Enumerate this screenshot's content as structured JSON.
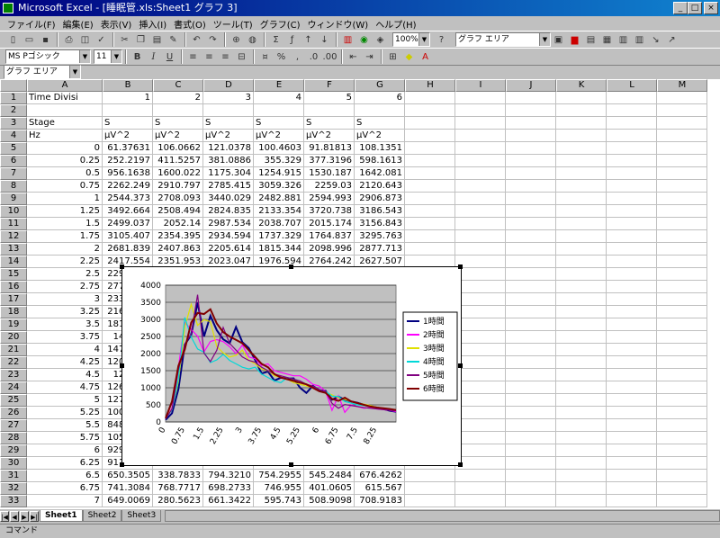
{
  "window": {
    "title": "Microsoft Excel - [睡眠管.xls:Sheet1 グラフ 3]"
  },
  "menu": [
    "ファイル(F)",
    "編集(E)",
    "表示(V)",
    "挿入(I)",
    "書式(O)",
    "ツール(T)",
    "グラフ(C)",
    "ウィンドウ(W)",
    "ヘルプ(H)"
  ],
  "toolbar": {
    "chart_area_label": "グラフ エリア",
    "zoom": "100%"
  },
  "format": {
    "font": "MS Pゴシック",
    "size": "11"
  },
  "formula": {
    "name_box": "グラフ エリア"
  },
  "columns": [
    "A",
    "B",
    "C",
    "D",
    "E",
    "F",
    "G",
    "H",
    "I",
    "J",
    "K",
    "L",
    "M"
  ],
  "rows": [
    {
      "n": "1",
      "A": "Time Divisi",
      "B": "1",
      "C": "2",
      "D": "3",
      "E": "4",
      "F": "5",
      "G": "6"
    },
    {
      "n": "2"
    },
    {
      "n": "3",
      "A": "Stage",
      "B": "S",
      "C": "S",
      "D": "S",
      "E": "S",
      "F": "S",
      "G": "S"
    },
    {
      "n": "4",
      "A": "Hz",
      "B": "μV^2",
      "C": "μV^2",
      "D": "μV^2",
      "E": "μV^2",
      "F": "μV^2",
      "G": "μV^2"
    },
    {
      "n": "5",
      "A": "0",
      "B": "61.37631",
      "C": "106.0662",
      "D": "121.0378",
      "E": "100.4603",
      "F": "91.81813",
      "G": "108.1351"
    },
    {
      "n": "6",
      "A": "0.25",
      "B": "252.2197",
      "C": "411.5257",
      "D": "381.0886",
      "E": "355.329",
      "F": "377.3196",
      "G": "598.1613"
    },
    {
      "n": "7",
      "A": "0.5",
      "B": "956.1638",
      "C": "1600.022",
      "D": "1175.304",
      "E": "1254.915",
      "F": "1530.187",
      "G": "1642.081"
    },
    {
      "n": "8",
      "A": "0.75",
      "B": "2262.249",
      "C": "2910.797",
      "D": "2785.415",
      "E": "3059.326",
      "F": "2259.03",
      "G": "2120.643"
    },
    {
      "n": "9",
      "A": "1",
      "B": "2544.373",
      "C": "2708.093",
      "D": "3440.029",
      "E": "2482.881",
      "F": "2594.993",
      "G": "2906.873"
    },
    {
      "n": "10",
      "A": "1.25",
      "B": "3492.664",
      "C": "2508.494",
      "D": "2824.835",
      "E": "2133.354",
      "F": "3720.738",
      "G": "3186.543"
    },
    {
      "n": "11",
      "A": "1.5",
      "B": "2499.037",
      "C": "2052.14",
      "D": "2987.534",
      "E": "2038.707",
      "F": "2015.174",
      "G": "3156.843"
    },
    {
      "n": "12",
      "A": "1.75",
      "B": "3105.407",
      "C": "2354.395",
      "D": "2934.594",
      "E": "1737.329",
      "F": "1764.837",
      "G": "3295.763"
    },
    {
      "n": "13",
      "A": "2",
      "B": "2681.839",
      "C": "2407.863",
      "D": "2205.614",
      "E": "1815.344",
      "F": "2098.996",
      "G": "2877.713"
    },
    {
      "n": "14",
      "A": "2.25",
      "B": "2417.554",
      "C": "2351.953",
      "D": "2023.047",
      "E": "1976.594",
      "F": "2764.242",
      "G": "2627.507"
    },
    {
      "n": "15",
      "A": "2.5",
      "B": "2299.808"
    },
    {
      "n": "16",
      "A": "2.75",
      "B": "2775.406"
    },
    {
      "n": "17",
      "A": "3",
      "B": "2331.574"
    },
    {
      "n": "18",
      "A": "3.25",
      "B": "2161.485"
    },
    {
      "n": "19",
      "A": "3.5",
      "B": "1812.295"
    },
    {
      "n": "20",
      "A": "3.75",
      "B": "1416.58"
    },
    {
      "n": "21",
      "A": "4",
      "B": "1476.564"
    },
    {
      "n": "22",
      "A": "4.25",
      "B": "1208.134"
    },
    {
      "n": "23",
      "A": "4.5",
      "B": "1294.11"
    },
    {
      "n": "24",
      "A": "4.75",
      "B": "1264.676"
    },
    {
      "n": "25",
      "A": "5",
      "B": "1273.637"
    },
    {
      "n": "26",
      "A": "5.25",
      "B": "1002.696"
    },
    {
      "n": "27",
      "A": "5.5",
      "B": "848.2638"
    },
    {
      "n": "28",
      "A": "5.75",
      "B": "1057.856"
    },
    {
      "n": "29",
      "A": "6",
      "B": "929.7643"
    },
    {
      "n": "30",
      "A": "6.25",
      "B": "911.3401"
    },
    {
      "n": "31",
      "A": "6.5",
      "B": "650.3505",
      "C": "338.7833",
      "D": "794.3210",
      "E": "754.2955",
      "F": "545.2484",
      "G": "676.4262"
    },
    {
      "n": "32",
      "A": "6.75",
      "B": "741.3084",
      "C": "768.7717",
      "D": "698.2733",
      "E": "746.955",
      "F": "401.0605",
      "G": "615.567"
    },
    {
      "n": "33",
      "A": "7",
      "B": "649.0069",
      "C": "280.5623",
      "D": "661.3422",
      "E": "595.743",
      "F": "508.9098",
      "G": "708.9183"
    }
  ],
  "chart_data": {
    "type": "line",
    "x": [
      0,
      0.25,
      0.5,
      0.75,
      1,
      1.25,
      1.5,
      1.75,
      2,
      2.25,
      2.5,
      2.75,
      3,
      3.25,
      3.5,
      3.75,
      4,
      4.25,
      4.5,
      4.75,
      5,
      5.25,
      5.5,
      5.75,
      6,
      6.25,
      6.5,
      6.75,
      7,
      7.25,
      7.5,
      7.75,
      8,
      8.25,
      8.5,
      8.75,
      9
    ],
    "xticks": [
      "0",
      "0.75",
      "1.5",
      "2.25",
      "3",
      "3.75",
      "4.5",
      "5.25",
      "6",
      "6.75",
      "7.5",
      "8.25"
    ],
    "yticks": [
      "0",
      "500",
      "1000",
      "1500",
      "2000",
      "2500",
      "3000",
      "3500",
      "4000"
    ],
    "ylim": [
      0,
      4000
    ],
    "grid": true,
    "legend_position": "right",
    "series": [
      {
        "name": "1時間",
        "color": "#000080",
        "values": [
          61,
          252,
          956,
          2262,
          2544,
          3493,
          2499,
          3105,
          2682,
          2418,
          2300,
          2775,
          2332,
          2161,
          1812,
          1417,
          1477,
          1208,
          1294,
          1265,
          1274,
          1003,
          848,
          1058,
          930,
          911,
          650,
          741,
          649,
          600,
          560,
          500,
          450,
          420,
          380,
          330,
          300
        ]
      },
      {
        "name": "2時間",
        "color": "#ff00ff",
        "values": [
          106,
          412,
          1600,
          2911,
          2708,
          2508,
          2052,
          2354,
          2408,
          2352,
          2200,
          2000,
          2250,
          1900,
          1850,
          1650,
          1700,
          1500,
          1450,
          1400,
          1350,
          1350,
          1250,
          1100,
          1050,
          900,
          339,
          769,
          281,
          500,
          450,
          400,
          420,
          380,
          360,
          340,
          300
        ]
      },
      {
        "name": "3時間",
        "color": "#e0e000",
        "values": [
          121,
          381,
          1175,
          2785,
          3440,
          2825,
          2988,
          2935,
          2206,
          2023,
          1900,
          1950,
          2100,
          1800,
          1700,
          1550,
          1500,
          1350,
          1300,
          1250,
          1150,
          1100,
          1050,
          1000,
          900,
          850,
          794,
          698,
          661,
          600,
          550,
          520,
          480,
          430,
          400,
          380,
          350
        ]
      },
      {
        "name": "4時間",
        "color": "#00d8d8",
        "values": [
          100,
          355,
          1255,
          3059,
          2483,
          2133,
          2039,
          1737,
          1815,
          1977,
          1800,
          1700,
          1600,
          1550,
          1600,
          1400,
          1300,
          1200,
          1150,
          1300,
          1250,
          1200,
          1100,
          1000,
          950,
          900,
          754,
          747,
          596,
          550,
          500,
          480,
          450,
          420,
          400,
          380,
          350
        ]
      },
      {
        "name": "5時間",
        "color": "#800080",
        "values": [
          92,
          377,
          1530,
          2259,
          2595,
          3721,
          2015,
          1765,
          2099,
          2764,
          2300,
          2100,
          1900,
          1800,
          1750,
          1600,
          1500,
          1400,
          1350,
          1300,
          1250,
          1200,
          1100,
          1050,
          950,
          900,
          545,
          401,
          509,
          480,
          450,
          420,
          400,
          380,
          360,
          340,
          320
        ]
      },
      {
        "name": "6時間",
        "color": "#800000",
        "values": [
          108,
          598,
          1642,
          2121,
          2907,
          3187,
          3157,
          3296,
          2878,
          2628,
          2500,
          2400,
          2300,
          2100,
          1900,
          1700,
          1600,
          1400,
          1300,
          1250,
          1200,
          1150,
          1100,
          1000,
          900,
          850,
          676,
          616,
          709,
          600,
          550,
          500,
          450,
          420,
          400,
          380,
          350
        ]
      }
    ]
  },
  "sheets": [
    "Sheet1",
    "Sheet2",
    "Sheet3"
  ],
  "status": "コマンド"
}
